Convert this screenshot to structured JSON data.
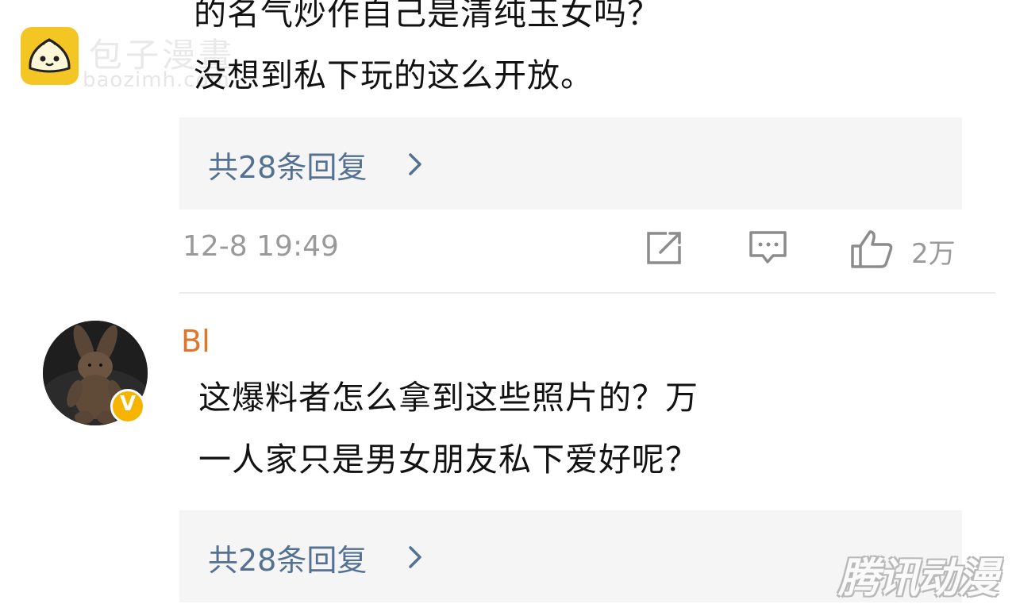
{
  "watermark": {
    "site_name": "包子漫畫",
    "site_url": "baozimh.com",
    "logo_color": "#f3c623",
    "corner_mark": "腾讯动漫"
  },
  "comments": [
    {
      "text_lines": [
        "的名气炒作自己是清纯玉女吗？",
        "没想到私下玩的这么开放。"
      ],
      "replies_label": "共28条回复",
      "time": "12-8 19:49",
      "actions": [
        "repost-icon",
        "comment-icon",
        "like-icon"
      ],
      "likes": "2万"
    },
    {
      "username": "Bl",
      "verified": true,
      "verified_badge": "V",
      "text_lines": [
        "这爆料者怎么拿到这些照片的？万",
        "一人家只是男女朋友私下爱好呢？"
      ],
      "replies_label": "共28条回复"
    }
  ],
  "colors": {
    "link": "#547192",
    "username": "#e0762b",
    "muted": "#9a9a9a",
    "verified": "#f6b400",
    "replies_bg": "#f5f5f5"
  }
}
